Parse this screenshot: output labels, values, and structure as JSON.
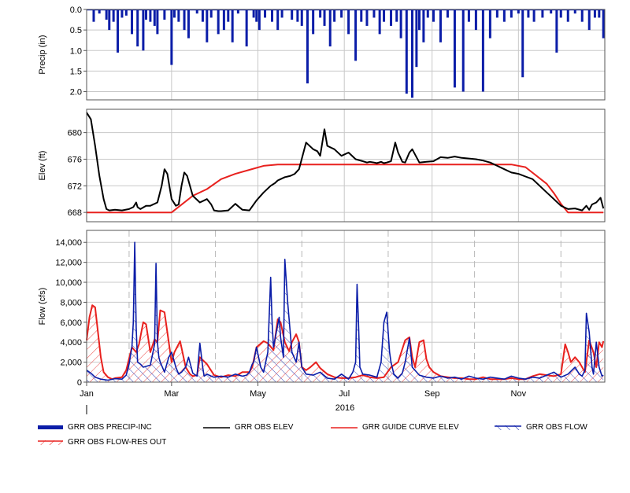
{
  "chart_data": [
    {
      "type": "bar",
      "ylabel": "Precip (in)",
      "yticks": [
        "0.0",
        "0.5",
        "1.0",
        "1.5",
        "2.0"
      ],
      "ylim": [
        0,
        2.2
      ],
      "y_inverted": true,
      "x_days": [
        5,
        9,
        14,
        16,
        19,
        22,
        25,
        28,
        32,
        36,
        40,
        42,
        45,
        48,
        50,
        55,
        60,
        62,
        65,
        69,
        72,
        78,
        82,
        85,
        88,
        93,
        97,
        100,
        103,
        107,
        113,
        118,
        120,
        122,
        126,
        131,
        135,
        138,
        145,
        149,
        152,
        156,
        160,
        165,
        168,
        172,
        175,
        180,
        185,
        190,
        194,
        198,
        203,
        207,
        210,
        215,
        219,
        222,
        226,
        230,
        233,
        235,
        238,
        241,
        245,
        250,
        255,
        260,
        266,
        270,
        275,
        280,
        285,
        290,
        295,
        300,
        305,
        308,
        312,
        316,
        322,
        328,
        332,
        335,
        340,
        345,
        350,
        355,
        359,
        362,
        365
      ],
      "values": [
        0.3,
        0.1,
        0.25,
        0.5,
        0.3,
        1.05,
        0.2,
        0.15,
        0.6,
        0.9,
        1.0,
        0.25,
        0.3,
        0.4,
        0.6,
        0.25,
        1.35,
        0.2,
        0.3,
        0.5,
        0.7,
        0.1,
        0.3,
        0.8,
        0.2,
        0.6,
        0.5,
        0.3,
        0.8,
        0.1,
        0.9,
        0.2,
        0.3,
        0.5,
        0.2,
        0.3,
        0.5,
        0.2,
        0.25,
        0.3,
        0.4,
        1.8,
        0.6,
        0.2,
        0.4,
        0.9,
        0.3,
        0.2,
        0.6,
        1.25,
        0.3,
        0.4,
        0.2,
        0.6,
        0.3,
        0.4,
        0.3,
        0.7,
        2.05,
        2.15,
        1.4,
        0.5,
        0.8,
        0.2,
        0.3,
        0.8,
        0.2,
        1.9,
        2.0,
        0.3,
        0.5,
        2.0,
        0.7,
        0.2,
        0.3,
        0.2,
        0.1,
        1.65,
        0.2,
        0.3,
        0.2,
        0.1,
        1.05,
        0.2,
        0.3,
        0.1,
        0.3,
        0.5,
        0.2,
        0.2,
        0.7
      ]
    },
    {
      "type": "line",
      "ylabel": "Elev (ft)",
      "yticks": [
        "668",
        "672",
        "676",
        "680"
      ],
      "ylim": [
        666.6,
        683.5
      ],
      "series": [
        {
          "name": "GRR OBS ELEV",
          "color": "#000000",
          "x_days": [
            0,
            3,
            6,
            9,
            12,
            14,
            16,
            20,
            25,
            30,
            33,
            35,
            36,
            38,
            42,
            45,
            50,
            53,
            55,
            57,
            60,
            63,
            65,
            67,
            69,
            71,
            75,
            80,
            85,
            88,
            90,
            93,
            95,
            100,
            105,
            110,
            115,
            120,
            125,
            130,
            133,
            135,
            137,
            140,
            142,
            144,
            147,
            150,
            155,
            160,
            163,
            165,
            168,
            170,
            175,
            180,
            185,
            190,
            195,
            198,
            200,
            203,
            205,
            208,
            210,
            212,
            215,
            218,
            220,
            223,
            225,
            228,
            230,
            235,
            240,
            245,
            250,
            255,
            260,
            265,
            270,
            275,
            280,
            285,
            290,
            295,
            300,
            305,
            310,
            315,
            320,
            325,
            330,
            335,
            340,
            345,
            350,
            353,
            355,
            357,
            360,
            363,
            365
          ],
          "values": [
            683.0,
            682.0,
            678.0,
            673.5,
            670.0,
            668.5,
            668.3,
            668.4,
            668.3,
            668.5,
            668.8,
            669.5,
            668.8,
            668.5,
            669.0,
            669.0,
            669.5,
            672.0,
            674.5,
            673.8,
            670.0,
            669.0,
            669.2,
            672.0,
            674.0,
            673.5,
            670.5,
            669.5,
            670.0,
            669.2,
            668.3,
            668.2,
            668.2,
            668.3,
            669.3,
            668.4,
            668.3,
            669.8,
            671.0,
            672.0,
            672.4,
            672.8,
            673.0,
            673.3,
            673.4,
            673.5,
            673.8,
            674.5,
            678.5,
            677.5,
            677.2,
            676.5,
            680.5,
            678.0,
            677.5,
            676.5,
            677.0,
            676.0,
            675.7,
            675.5,
            675.6,
            675.5,
            675.4,
            675.6,
            675.4,
            675.5,
            675.7,
            678.5,
            677.0,
            675.6,
            675.5,
            677.0,
            677.5,
            675.5,
            675.6,
            675.7,
            676.3,
            676.2,
            676.4,
            676.2,
            676.1,
            676.0,
            675.8,
            675.5,
            675.0,
            674.5,
            674.0,
            673.8,
            673.4,
            673.0,
            672.0,
            671.0,
            670.0,
            669.0,
            668.5,
            668.6,
            668.3,
            669.0,
            668.4,
            669.2,
            669.5,
            670.2,
            668.6
          ]
        },
        {
          "name": "GRR GUIDE CURVE ELEV",
          "color": "#e8211e",
          "x_days": [
            0,
            60,
            75,
            85,
            95,
            105,
            115,
            125,
            135,
            140,
            300,
            310,
            325,
            330,
            335,
            340,
            365
          ],
          "values": [
            668.0,
            668.0,
            670.5,
            671.5,
            673.0,
            673.8,
            674.4,
            675.0,
            675.2,
            675.2,
            675.2,
            674.8,
            672.3,
            670.9,
            669.3,
            668.0,
            668.0
          ]
        }
      ]
    },
    {
      "type": "line",
      "ylabel": "Flow (cfs)",
      "yticks": [
        "0",
        "2,000",
        "4,000",
        "6,000",
        "8,000",
        "10,000",
        "12,000",
        "14,000"
      ],
      "ylim": [
        0,
        15200
      ],
      "x_tick_labels": [
        "Jan",
        "Mar",
        "May",
        "Jul",
        "Sep",
        "Nov"
      ],
      "x_year_label": "2016",
      "series": [
        {
          "name": "GRR OBS FLOW",
          "color": "#0b1da8",
          "x_days": [
            0,
            3,
            6,
            10,
            15,
            20,
            25,
            28,
            30,
            32,
            33,
            34,
            35,
            36,
            38,
            40,
            45,
            48,
            49,
            50,
            51,
            52,
            55,
            58,
            60,
            63,
            65,
            67,
            70,
            72,
            75,
            78,
            80,
            82,
            83,
            85,
            88,
            90,
            95,
            100,
            105,
            110,
            113,
            115,
            117,
            118,
            120,
            123,
            125,
            128,
            130,
            131,
            132,
            134,
            136,
            137,
            139,
            140,
            142,
            145,
            148,
            150,
            152,
            155,
            160,
            165,
            170,
            175,
            180,
            185,
            188,
            190,
            191,
            192,
            193,
            195,
            200,
            205,
            208,
            210,
            212,
            214,
            215,
            217,
            220,
            223,
            225,
            228,
            230,
            235,
            240,
            245,
            250,
            255,
            260,
            265,
            270,
            275,
            280,
            285,
            290,
            295,
            300,
            305,
            310,
            315,
            320,
            325,
            330,
            335,
            340,
            345,
            348,
            350,
            352,
            353,
            355,
            357,
            358,
            360,
            362,
            364,
            365
          ],
          "values": [
            1200,
            900,
            500,
            300,
            200,
            350,
            300,
            700,
            1800,
            3500,
            6000,
            14000,
            5500,
            2000,
            1800,
            1500,
            1700,
            3800,
            11900,
            4000,
            2500,
            2000,
            1000,
            2500,
            3000,
            1500,
            800,
            1000,
            1500,
            2500,
            900,
            600,
            3900,
            1500,
            600,
            800,
            600,
            500,
            600,
            500,
            800,
            600,
            700,
            1000,
            1800,
            2000,
            3500,
            1500,
            1000,
            3000,
            10500,
            6000,
            3500,
            5000,
            6500,
            4500,
            2500,
            12300,
            8000,
            3000,
            2000,
            4000,
            1500,
            800,
            700,
            1000,
            400,
            300,
            800,
            300,
            1000,
            2000,
            9800,
            6000,
            1500,
            800,
            700,
            500,
            2000,
            6000,
            7000,
            3000,
            2000,
            800,
            400,
            900,
            2000,
            4400,
            1500,
            700,
            500,
            400,
            600,
            400,
            500,
            300,
            600,
            400,
            300,
            500,
            400,
            300,
            600,
            400,
            300,
            500,
            400,
            700,
            1000,
            500,
            800,
            1500,
            800,
            600,
            1200,
            6900,
            5000,
            1500,
            800,
            4000,
            1500,
            600,
            700
          ]
        },
        {
          "name": "GRR OBS FLOW-RES OUT",
          "color": "#e8211e",
          "x_days": [
            0,
            2,
            4,
            6,
            8,
            10,
            12,
            15,
            18,
            20,
            25,
            28,
            32,
            35,
            37,
            40,
            42,
            45,
            48,
            50,
            52,
            55,
            58,
            60,
            62,
            66,
            70,
            73,
            75,
            78,
            80,
            85,
            90,
            95,
            100,
            105,
            110,
            115,
            117,
            120,
            125,
            128,
            132,
            135,
            137,
            140,
            143,
            145,
            148,
            150,
            152,
            155,
            158,
            162,
            165,
            170,
            175,
            180,
            185,
            190,
            195,
            200,
            205,
            210,
            215,
            220,
            225,
            228,
            230,
            232,
            235,
            238,
            240,
            242,
            245,
            250,
            255,
            260,
            265,
            270,
            275,
            280,
            285,
            290,
            295,
            300,
            305,
            310,
            315,
            320,
            325,
            330,
            335,
            338,
            340,
            342,
            345,
            348,
            350,
            352,
            355,
            358,
            360,
            362,
            364,
            365
          ],
          "values": [
            4200,
            6500,
            7700,
            7500,
            5000,
            2500,
            1000,
            500,
            300,
            400,
            500,
            1200,
            3500,
            3000,
            3800,
            6000,
            5800,
            3000,
            4300,
            4000,
            7200,
            7000,
            4000,
            2000,
            3000,
            4100,
            1500,
            800,
            600,
            700,
            2500,
            1800,
            700,
            500,
            700,
            600,
            1000,
            1000,
            1500,
            3500,
            4100,
            3900,
            3200,
            6300,
            6000,
            4000,
            3100,
            4000,
            4800,
            4000,
            1500,
            1200,
            1500,
            2000,
            1400,
            800,
            500,
            400,
            400,
            500,
            700,
            500,
            400,
            500,
            1500,
            2000,
            4200,
            4500,
            2500,
            1500,
            4000,
            4200,
            2300,
            1500,
            1000,
            600,
            500,
            400,
            400,
            300,
            300,
            500,
            300,
            300,
            300,
            400,
            300,
            300,
            600,
            800,
            700,
            600,
            800,
            3800,
            3000,
            2000,
            2500,
            2000,
            1500,
            1000,
            4200,
            3000,
            1500,
            4000,
            3500,
            4100,
            4000
          ]
        }
      ]
    }
  ],
  "legend": [
    {
      "label": "GRR OBS PRECIP-INC",
      "color": "#0b1da8",
      "style": "bar"
    },
    {
      "label": "GRR OBS ELEV",
      "color": "#000000",
      "style": "line"
    },
    {
      "label": "GRR GUIDE CURVE ELEV",
      "color": "#e8211e",
      "style": "line"
    },
    {
      "label": "GRR OBS FLOW",
      "color": "#0b1da8",
      "style": "hatch"
    },
    {
      "label": "GRR OBS FLOW-RES OUT",
      "color": "#e8211e",
      "style": "hatch"
    }
  ]
}
